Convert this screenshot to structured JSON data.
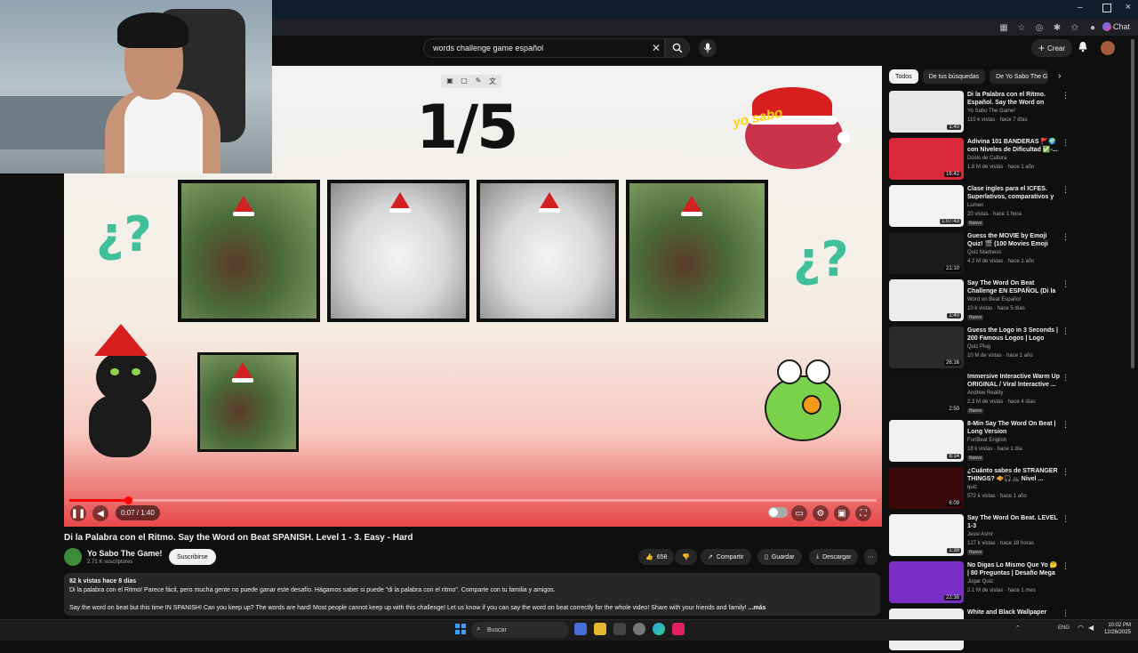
{
  "browser": {
    "chat_label": "Chat"
  },
  "header": {
    "search_value": "words challenge game español",
    "create_label": "Crear"
  },
  "video_overlay": {
    "counter": "1/5",
    "logo_text": "yo sabo"
  },
  "player": {
    "time": "0:07 / 1:40",
    "progress": 0.07
  },
  "video": {
    "title": "Di la Palabra con el Ritmo. Say the Word on Beat SPANISH. Level 1 - 3. Easy - Hard",
    "channel": "Yo Sabo The Game!",
    "subscribers": "2.71 K suscriptores",
    "subscribe_label": "Suscribirse",
    "likes": "658",
    "share_label": "Compartir",
    "save_label": "Guardar",
    "download_label": "Descargar",
    "desc_stats": "82 k vistas  hace 8 días",
    "desc_line1": "Di la palabra con el Ritmo! Parece fácil, pero mucha gente no puede ganar este desafío. Hágamos saber si puede \"di la palabra con el ritmo\". Comparte con tu familia y amigos.",
    "desc_line2": "Say the word on beat but this time IN SPANISH! Can you keep up? The words are hard! Most people cannot keep up with this challenge! Let us know if you can say the word on beat correctly for the whole video! Share with your friends and family!",
    "more_label": "...más"
  },
  "chips": [
    "Todos",
    "De tus búsquedas",
    "De Yo Sabo The G"
  ],
  "recommendations": [
    {
      "title": "Di la Palabra con el Ritmo. Español. Say the Word on Beat...",
      "channel": "Yo Sabo The Game!",
      "meta": "110 k vistas · hace 7 días",
      "duration": "1:40",
      "badge": "",
      "color": "#e8e8e8"
    },
    {
      "title": "Adivina 101 BANDERAS 🚩🌍 con Niveles de Dificultad ✅-...",
      "channel": "Dosis de Cultura",
      "meta": "1.8 M de vistas · hace 1 año",
      "duration": "16:42",
      "badge": "",
      "color": "#d8283a"
    },
    {
      "title": "Clase ingles para el ICFES. Superlativos, comparativos y ...",
      "channel": "Lumen",
      "meta": "20 vistas · hace 1 hora",
      "duration": "1:07:43",
      "badge": "Nuevo",
      "color": "#f4f4f4"
    },
    {
      "title": "Guess the MOVIE by Emoji Quiz! 🎬 (100 Movies Emoji Puzzles...",
      "channel": "Quiz Madness",
      "meta": "4.2 M de vistas · hace 1 año",
      "duration": "21:10",
      "badge": "",
      "color": "#1a1a1a"
    },
    {
      "title": "Say The Word On Beat Challenge EN ESPAÑOL (Di la ...",
      "channel": "Word on Beat Español",
      "meta": "10 k vistas · hace 5 días",
      "duration": "1:40",
      "badge": "Nuevo",
      "color": "#ececec"
    },
    {
      "title": "Guess the Logo in 3 Seconds | 200 Famous Logos | Logo Qui...",
      "channel": "Quiz Plug",
      "meta": "10 M de vistas · hace 1 año",
      "duration": "26:16",
      "badge": "",
      "color": "#2a2a2a"
    },
    {
      "title": "Immersive Interactive Warm Up ORIGINAL / Viral Interactive ...",
      "channel": "Andrew Reality",
      "meta": "2.3 M de vistas · hace 4 días",
      "duration": "2:50",
      "badge": "Nuevo",
      "color": "#111111"
    },
    {
      "title": "8-Min Say The Word On Beat | Long Version",
      "channel": "FunBeat English",
      "meta": "18 k vistas · hace 1 día",
      "duration": "8:14",
      "badge": "Nuevo",
      "color": "#f0f0f0"
    },
    {
      "title": "¿Cuánto sabes de STRANGER THINGS? 🧇🎧🚲 Nivel ...",
      "channel": "quiz",
      "meta": "572 k vistas · hace 1 año",
      "duration": "6:09",
      "badge": "",
      "color": "#3a0a0a"
    },
    {
      "title": "Say The Word On Beat. LEVEL 1-3",
      "channel": "Jessi Asmr",
      "meta": "127 k vistas · hace 18 horas",
      "duration": "1:39",
      "badge": "Nuevo",
      "color": "#f2f2f2"
    },
    {
      "title": "No Digas Lo Mismo Que Yo 🤔 | 80 Preguntas | Desafío Mega ...",
      "channel": "Jugar Quiz",
      "meta": "2.1 M de vistas · hace 1 mes",
      "duration": "22:38",
      "badge": "",
      "color": "#7a2fc4"
    },
    {
      "title": "White and Black Wallpaper",
      "channel": "",
      "meta": "",
      "duration": "",
      "badge": "",
      "color": "#eeeeee"
    }
  ],
  "taskbar": {
    "search_placeholder": "Buscar",
    "lang": "ENG",
    "time": "10:02 PM",
    "date": "12/26/2025"
  }
}
